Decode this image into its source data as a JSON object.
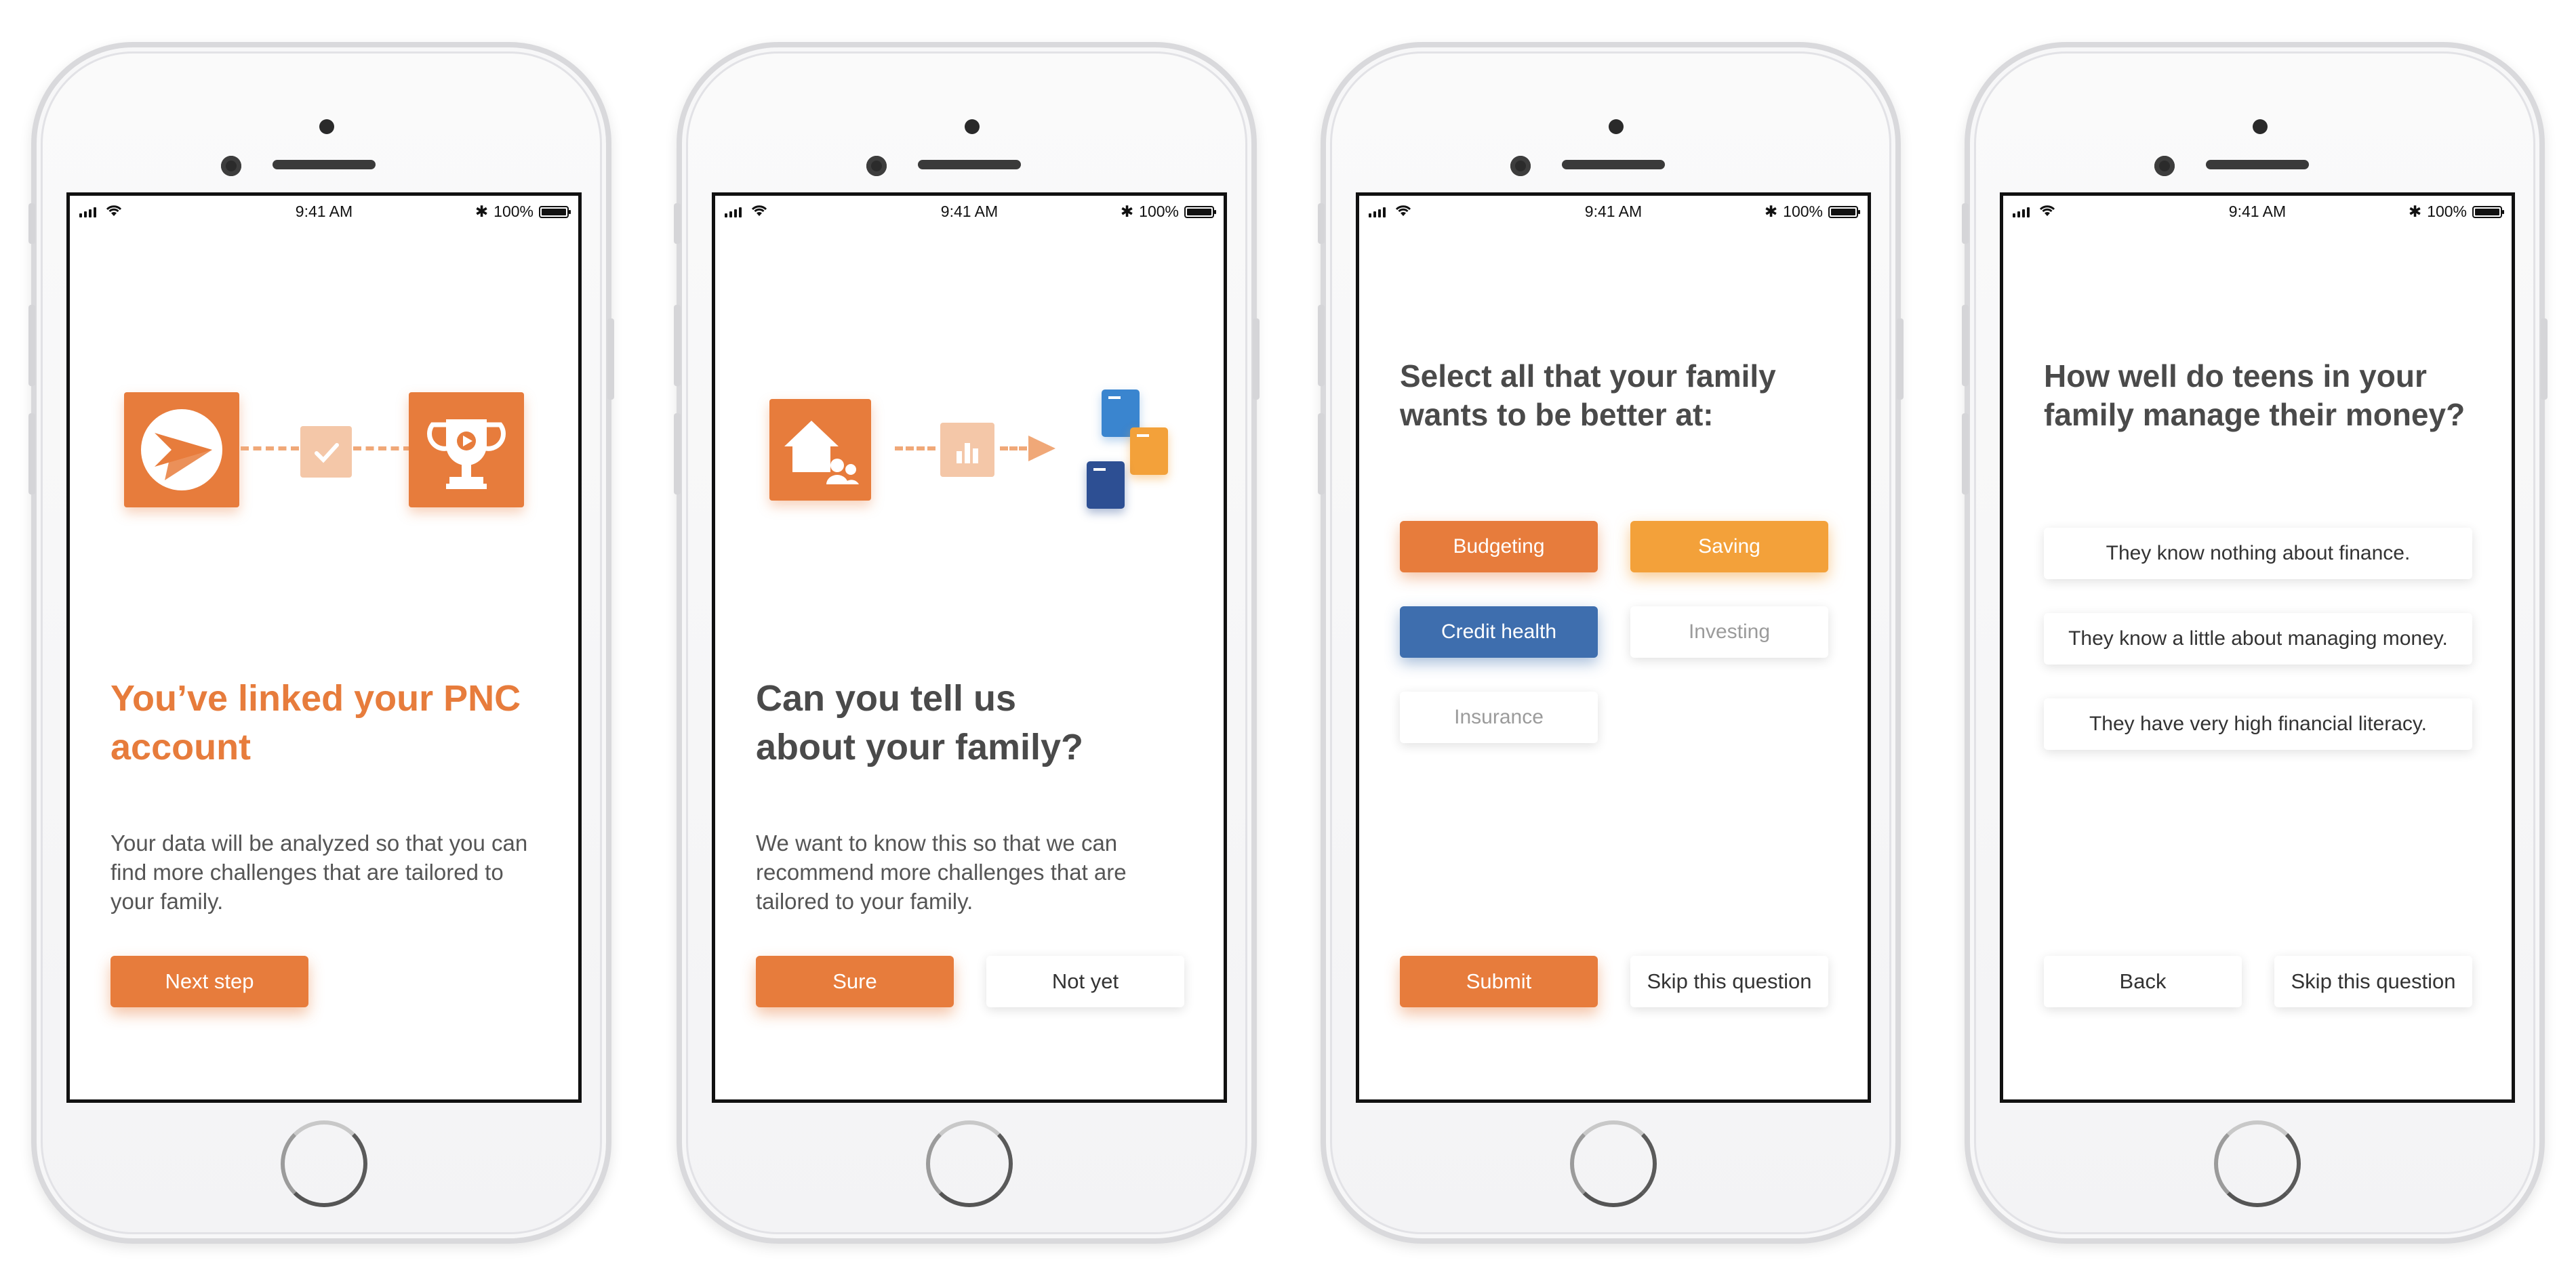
{
  "status_bar": {
    "time": "9:41 AM",
    "battery": "100%"
  },
  "screens": [
    {
      "title_line1": "You’ve linked your PNC",
      "title_line2": "account",
      "body_line1": "Your data will be analyzed so that you can",
      "body_line2": "find more challenges that are tailored to",
      "body_line3": "your family.",
      "primary_button": "Next step"
    },
    {
      "title_line1": "Can you tell us",
      "title_line2": "about your family?",
      "body_line1": "We want to know this so that we can",
      "body_line2": "recommend more challenges that are",
      "body_line3": "tailored to your family.",
      "primary_button": "Sure",
      "secondary_button": "Not yet"
    },
    {
      "question_line1": "Select all that your family",
      "question_line2": "wants to be better at:",
      "chips": [
        "Budgeting",
        "Saving",
        "Credit health",
        "Investing",
        "Insurance"
      ],
      "primary_button": "Submit",
      "secondary_button": "Skip this question"
    },
    {
      "question_line1": "How well do teens in your",
      "question_line2": "family manage their money?",
      "options": [
        "They know nothing about finance.",
        "They know a little about managing money.",
        "They have very high financial literacy."
      ],
      "back_button": "Back",
      "secondary_button": "Skip this question"
    }
  ],
  "colors": {
    "accent_orange": "#e77c3c",
    "accent_yellow": "#f3a13a",
    "accent_blue": "#3e6eae"
  }
}
